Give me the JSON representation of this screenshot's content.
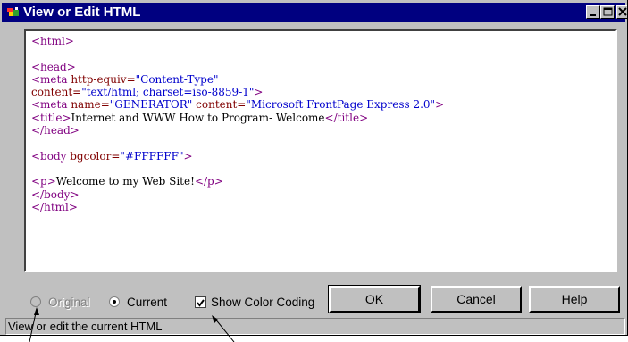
{
  "window": {
    "title": "View or Edit HTML",
    "icon": "frontpage-app-icon",
    "controls": [
      "minimize-icon",
      "maximize-icon",
      "close-icon"
    ]
  },
  "editor": {
    "lines": [
      [
        {
          "t": "tag",
          "s": "<html>"
        }
      ],
      [],
      [
        {
          "t": "tag",
          "s": "<head>"
        }
      ],
      [
        {
          "t": "tag",
          "s": "<meta "
        },
        {
          "t": "attr",
          "s": "http-equiv="
        },
        {
          "t": "val",
          "s": "\"Content-Type\""
        }
      ],
      [
        {
          "t": "attr",
          "s": "content="
        },
        {
          "t": "val",
          "s": "\"text/html; charset=iso-8859-1\""
        },
        {
          "t": "tag",
          "s": ">"
        }
      ],
      [
        {
          "t": "tag",
          "s": "<meta "
        },
        {
          "t": "attr",
          "s": "name="
        },
        {
          "t": "val",
          "s": "\"GENERATOR\""
        },
        {
          "t": "attr",
          "s": " content="
        },
        {
          "t": "val",
          "s": "\"Microsoft FrontPage Express 2.0\""
        },
        {
          "t": "tag",
          "s": ">"
        }
      ],
      [
        {
          "t": "tag",
          "s": "<title>"
        },
        {
          "t": "txt",
          "s": "Internet and WWW How to Program- Welcome"
        },
        {
          "t": "tag",
          "s": "</title>"
        }
      ],
      [
        {
          "t": "tag",
          "s": "</head>"
        }
      ],
      [],
      [
        {
          "t": "tag",
          "s": "<body "
        },
        {
          "t": "attr",
          "s": "bgcolor="
        },
        {
          "t": "val",
          "s": "\"#FFFFFF\""
        },
        {
          "t": "tag",
          "s": ">"
        }
      ],
      [],
      [
        {
          "t": "tag",
          "s": "<p>"
        },
        {
          "t": "txt",
          "s": "Welcome to my Web Site!"
        },
        {
          "t": "tag",
          "s": "</p>"
        }
      ],
      [
        {
          "t": "tag",
          "s": "</body>"
        }
      ],
      [
        {
          "t": "tag",
          "s": "</html>"
        }
      ]
    ]
  },
  "options": {
    "original_label": "Original",
    "original_selected": false,
    "original_enabled": false,
    "current_label": "Current",
    "current_selected": true,
    "color_coding_label": "Show Color Coding",
    "color_coding_checked": true
  },
  "buttons": {
    "ok": "OK",
    "cancel": "Cancel",
    "help": "Help"
  },
  "status": {
    "text": "View or edit the current HTML"
  },
  "colors": {
    "tag": "#800080",
    "attribute": "#800000",
    "value": "#0000cc",
    "titlebar": "#000080",
    "face": "#c0c0c0"
  }
}
